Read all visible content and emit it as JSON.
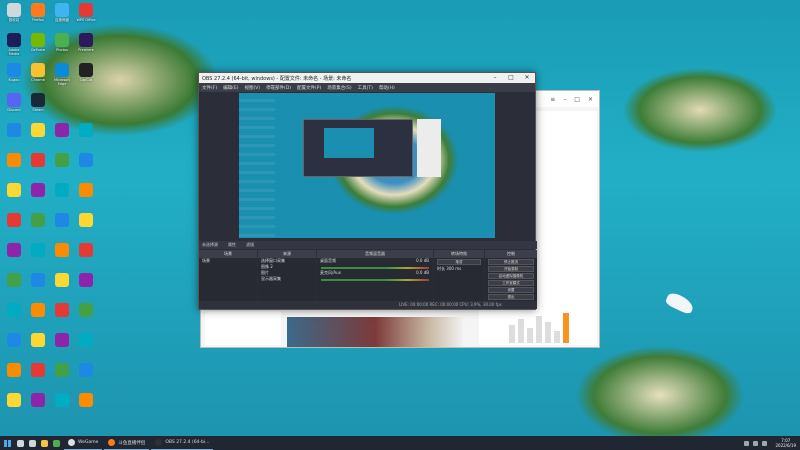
{
  "desktop": {
    "icons": [
      {
        "label": "回收站",
        "color": "#cfd8dc"
      },
      {
        "label": "Firefox",
        "color": "#ff7a1a"
      },
      {
        "label": "百度网盘",
        "color": "#3fb4f0"
      },
      {
        "label": "WPS Office",
        "color": "#e53935"
      },
      {
        "label": "Adobe Media Encoder",
        "color": "#1d1d5a"
      },
      {
        "label": "GeForce",
        "color": "#76b900"
      },
      {
        "label": "Photos",
        "color": "#4caf50"
      },
      {
        "label": "Premiere",
        "color": "#2b1b5c"
      },
      {
        "label": "Kugou",
        "color": "#1e88e5"
      },
      {
        "label": "Chrome",
        "color": "#fbc02d"
      },
      {
        "label": "Microsoft Edge",
        "color": "#0a8ad8"
      },
      {
        "label": "CapCut",
        "color": "#222222"
      },
      {
        "label": "Discord",
        "color": "#5865f2"
      },
      {
        "label": "Steam",
        "color": "#1b2838"
      }
    ]
  },
  "obs": {
    "title": "OBS 27.2.4 (64-bit, windows) - 配置文件: 未命名 - 场景: 未命名",
    "window_buttons": {
      "minimize": "–",
      "maximize": "□",
      "close": "✕"
    },
    "menu": [
      "文件(F)",
      "编辑(E)",
      "视图(V)",
      "停靠部件(D)",
      "配置文件(P)",
      "场景集合(S)",
      "工具(T)",
      "帮助(H)"
    ],
    "source_bar": {
      "label": "未选择源",
      "properties": "属性",
      "filters": "滤镜"
    },
    "docks": {
      "scenes": "场景",
      "sources": "来源",
      "mixer": "音频混音器",
      "transitions": "转场特效",
      "controls": "控制"
    },
    "scene_items": [
      "场景"
    ],
    "source_items": [
      "选择窗口采集",
      "图像 2",
      "图片",
      "显示器采集"
    ],
    "mixer_items": [
      {
        "name": "桌面音频",
        "level": "0.0 dB"
      },
      {
        "name": "麦克风/Aux",
        "level": "0.0 dB"
      }
    ],
    "transition": {
      "type": "渐变",
      "duration_label": "时长",
      "duration": "300 ms"
    },
    "controls": [
      "停止推流",
      "开始录制",
      "启动虚拟摄像机",
      "工作室模式",
      "设置",
      "退出"
    ],
    "status": "LIVE: 00:00:00   REC: 00:00:00   CPU: 3.9%, 30.00 fps"
  },
  "browser": {
    "window_buttons": {
      "menu": "≡",
      "minimize": "–",
      "maximize": "□",
      "close": "✕"
    },
    "chart_bars": [
      0.6,
      0.8,
      0.5,
      0.9,
      0.7,
      0.4,
      1.0
    ]
  },
  "taskbar": {
    "apps": [
      {
        "label": "WeGame",
        "color": "#e0e0e0"
      },
      {
        "label": "斗鱼直播伴侣",
        "color": "#ff7a1a"
      },
      {
        "label": "OBS 27.2.4 (64-bi...",
        "color": "#303030"
      }
    ],
    "pinned": [
      {
        "name": "search",
        "color": "#cfd8dc"
      },
      {
        "name": "task-view",
        "color": "#cfd8dc"
      },
      {
        "name": "file-explorer",
        "color": "#f4c542"
      },
      {
        "name": "chrome",
        "color": "#4caf50"
      }
    ],
    "clock": {
      "time": "7:07",
      "date": "2022/6/19"
    }
  }
}
